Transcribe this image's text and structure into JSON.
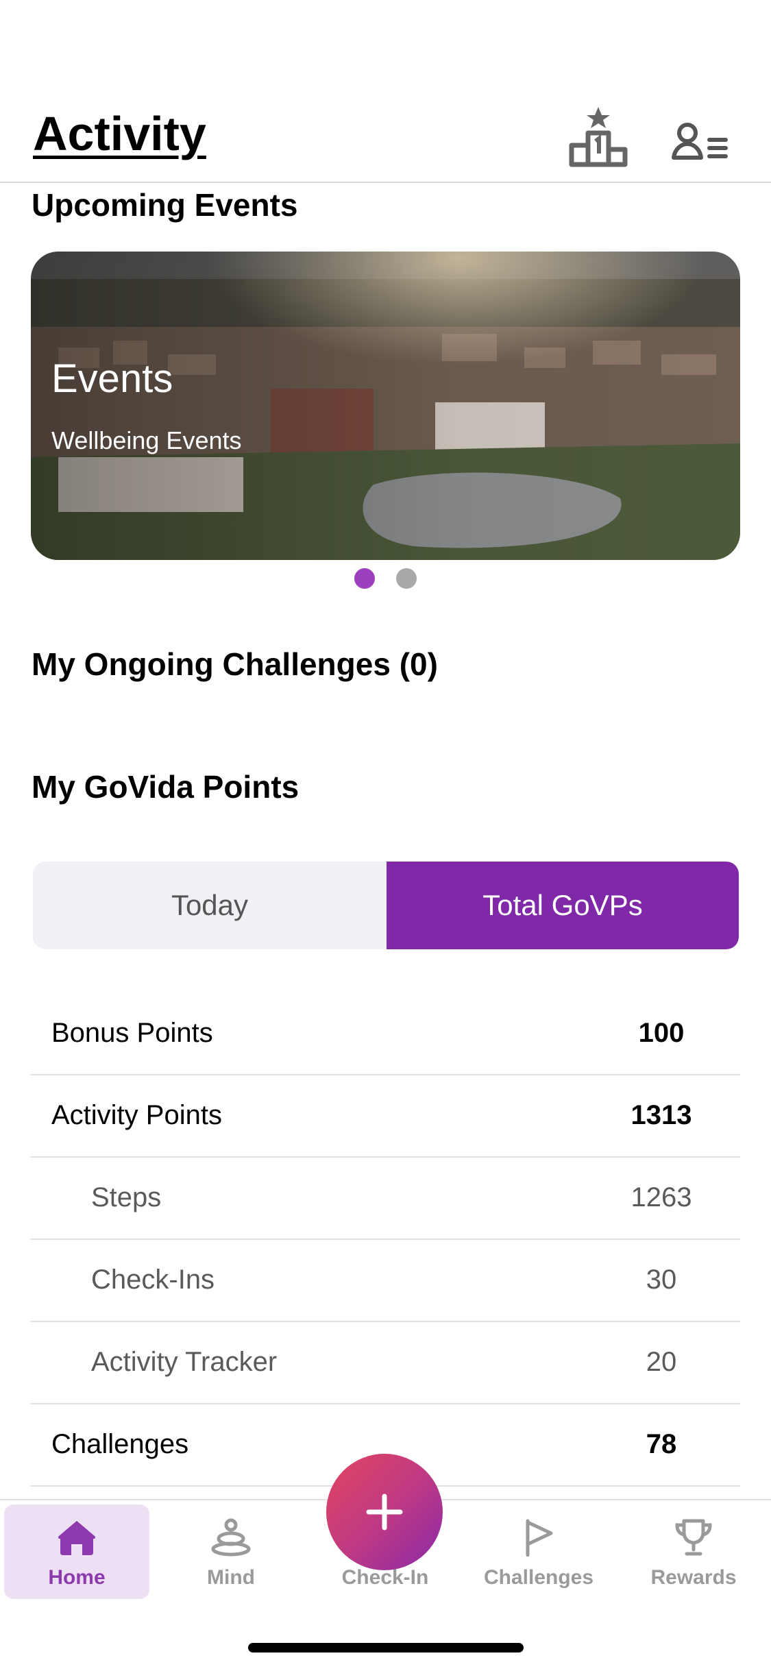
{
  "header": {
    "title": "Activity",
    "leaderboard_icon": "podium-icon",
    "profile_icon": "profile-menu-icon"
  },
  "upcoming": {
    "title": "Upcoming Events",
    "banner": {
      "title": "Events",
      "subtitle": "Wellbeing Events"
    },
    "pager": {
      "count": 2,
      "active_index": 0,
      "active_color": "#9b3fbf",
      "inactive_color": "#a9a9a9"
    }
  },
  "challenges": {
    "title": "My Ongoing Challenges (0)"
  },
  "points": {
    "title": "My GoVida Points",
    "segments": {
      "today": "Today",
      "total": "Total GoVPs",
      "selected": "Total GoVPs"
    },
    "rows": [
      {
        "label": "Bonus Points",
        "value": "100"
      },
      {
        "label": "Activity Points",
        "value": "1313"
      },
      {
        "label": "Steps",
        "value": "1263"
      },
      {
        "label": "Check-Ins",
        "value": "30"
      },
      {
        "label": "Activity Tracker",
        "value": "20"
      },
      {
        "label": "Challenges",
        "value": "78"
      }
    ]
  },
  "tabbar": {
    "home": "Home",
    "mind": "Mind",
    "checkin": "Check-In",
    "challenges": "Challenges",
    "rewards": "Rewards",
    "active": "Home"
  },
  "colors": {
    "accent": "#8029a8",
    "fab_start": "#e2465f",
    "fab_end": "#8a2aa8"
  }
}
